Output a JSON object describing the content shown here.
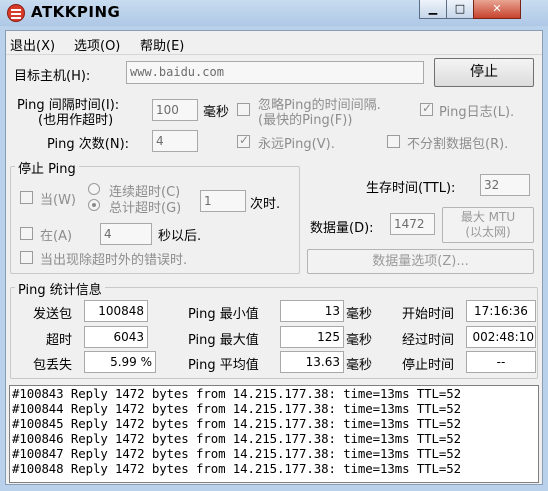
{
  "window": {
    "title": "ATKKPING"
  },
  "menu": {
    "items": [
      "退出(X)",
      "选项(O)",
      "帮助(E)"
    ]
  },
  "target": {
    "label": "目标主机(H):",
    "value": "www.baidu.com",
    "stop_label": "停止"
  },
  "interval": {
    "label": "Ping 间隔时间(I):",
    "label2": "(也用作超时)",
    "value": "100",
    "unit": "毫秒"
  },
  "ignore_ping_time": {
    "label": "忽略Ping的时间间隔.",
    "label2": "(最快的Ping(F))",
    "checked": false
  },
  "ping_log": {
    "label": "Ping日志(L).",
    "checked": true
  },
  "count": {
    "label": "Ping 次数(N):",
    "value": "4"
  },
  "forever": {
    "label": "永远Ping(V).",
    "checked": true
  },
  "no_fragment": {
    "label": "不分割数据包(R).",
    "checked": false
  },
  "stop_group": {
    "title": "停止 Ping",
    "when_label": "当(W)",
    "consecutive_timeout": "连续超时(C)",
    "total_timeout": "总计超时(G)",
    "timeout_value": "1",
    "times_label": "次时.",
    "at_label": "在(A)",
    "at_value": "4",
    "seconds_after": "秒以后.",
    "error_label": "当出现除超时外的错误时."
  },
  "ttl": {
    "label": "生存时间(TTL):",
    "value": "32"
  },
  "data_size": {
    "label": "数据量(D):",
    "value": "1472",
    "mtu_button": "最大 MTU",
    "mtu_button2": "(以太网)",
    "options_button": "数据量选项(Z)..."
  },
  "stats": {
    "title": "Ping  统计信息",
    "sent_label": "发送包",
    "sent": "100848",
    "timeout_label": "超时",
    "timeout": "6043",
    "loss_label": "包丢失",
    "loss": "5.99 %",
    "min_label": "Ping 最小值",
    "min": "13",
    "min_unit": "毫秒",
    "max_label": "Ping 最大值",
    "max": "125",
    "max_unit": "毫秒",
    "avg_label": "Ping 平均值",
    "avg": "13.63",
    "avg_unit": "毫秒",
    "start_label": "开始时间",
    "start": "17:16:36",
    "elapsed_label": "经过时间",
    "elapsed": "002:48:10",
    "stop_label": "停止时间",
    "stop": "--"
  },
  "log": [
    "#100843 Reply 1472 bytes from 14.215.177.38: time=13ms TTL=52",
    "#100844 Reply 1472 bytes from 14.215.177.38: time=13ms TTL=52",
    "#100845 Reply 1472 bytes from 14.215.177.38: time=13ms TTL=52",
    "#100846 Reply 1472 bytes from 14.215.177.38: time=13ms TTL=52",
    "#100847 Reply 1472 bytes from 14.215.177.38: time=13ms TTL=52",
    "#100848 Reply 1472 bytes from 14.215.177.38: time=13ms TTL=52"
  ],
  "colors": {
    "titlebar": "#aec8e6",
    "dialog": "#f0f0f0",
    "close_button": "#c7432e"
  }
}
